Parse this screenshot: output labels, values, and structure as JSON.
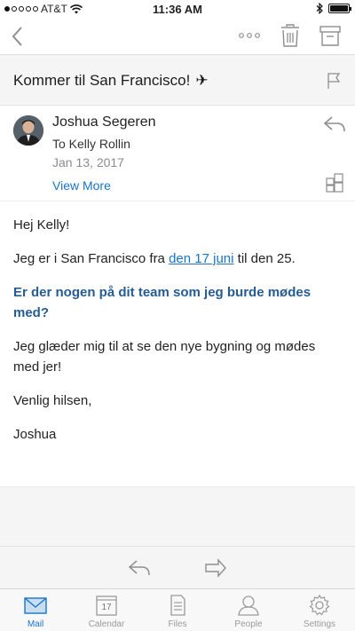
{
  "status_bar": {
    "carrier": "AT&T",
    "time": "11:36 AM"
  },
  "toolbar": {
    "back_icon": "chevron-left-icon",
    "more_icon": "ellipsis-icon",
    "delete_icon": "trash-icon",
    "archive_icon": "archive-icon"
  },
  "email": {
    "subject": "Kommer til San Francisco!",
    "subject_emoji": "✈",
    "sender_name": "Joshua Segeren",
    "recipient": "To Kelly Rollin",
    "date": "Jan 13, 2017",
    "view_more": "View More",
    "body": {
      "greeting": "Hej Kelly!",
      "line1_before": "Jeg er i San Francisco fra ",
      "line1_link": "den 17 juni",
      "line1_after": " til den 25.",
      "question": "Er der nogen på dit team som jeg burde mødes med?",
      "line2": "Jeg glæder mig til at se den nye bygning og mødes med jer!",
      "closing": "Venlig hilsen,",
      "signature": "Joshua"
    }
  },
  "tabs": [
    {
      "label": "Mail",
      "icon": "mail-icon",
      "active": true
    },
    {
      "label": "Calendar",
      "icon": "calendar-icon",
      "day": "17"
    },
    {
      "label": "Files",
      "icon": "files-icon"
    },
    {
      "label": "People",
      "icon": "people-icon"
    },
    {
      "label": "Settings",
      "icon": "gear-icon"
    }
  ],
  "colors": {
    "accent": "#1a74c8",
    "question": "#255c93",
    "subject_bg": "#f5f5f5"
  }
}
